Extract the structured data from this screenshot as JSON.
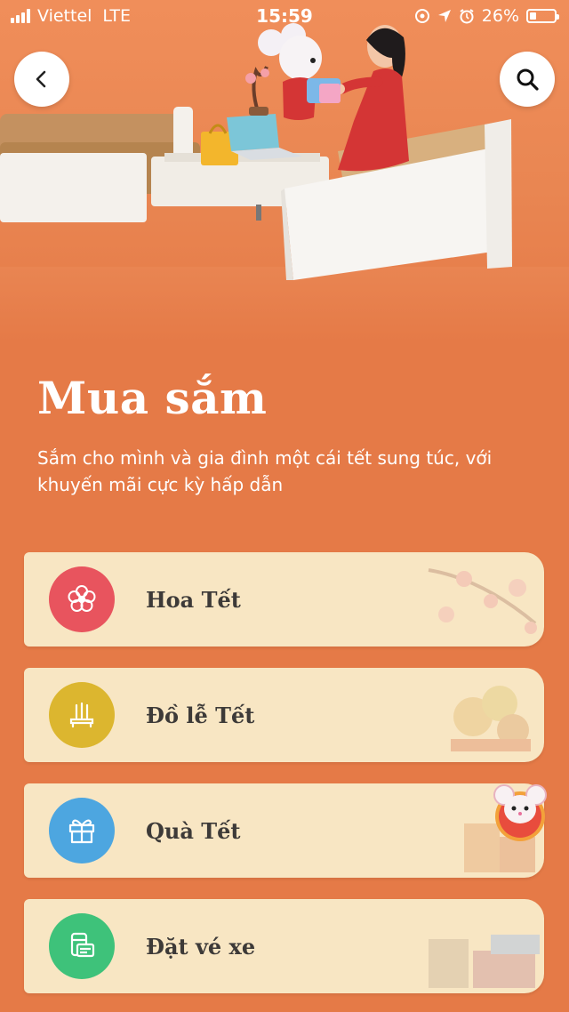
{
  "status_bar": {
    "carrier": "Viettel",
    "network": "LTE",
    "time": "15:59",
    "battery": "26%"
  },
  "header": {
    "back_icon": "chevron-left-icon",
    "search_icon": "search-icon"
  },
  "page": {
    "title": "Mua sắm",
    "subtitle": "Sắm cho mình và gia đình một cái tết sung túc, với khuyến mãi cực kỳ hấp dẫn"
  },
  "menu": [
    {
      "label": "Hoa Tết",
      "icon": "flower-icon",
      "color": "#e8545e"
    },
    {
      "label": "Đồ lễ Tết",
      "icon": "incense-icon",
      "color": "#dcb62f"
    },
    {
      "label": "Quà Tết",
      "icon": "gift-icon",
      "color": "#4da6e0"
    },
    {
      "label": "Đặt vé xe",
      "icon": "bus-ticket-icon",
      "color": "#3ec27a"
    }
  ],
  "colors": {
    "background": "#e57a47",
    "card": "#f8e6c3",
    "text_dark": "#3d3a38"
  }
}
